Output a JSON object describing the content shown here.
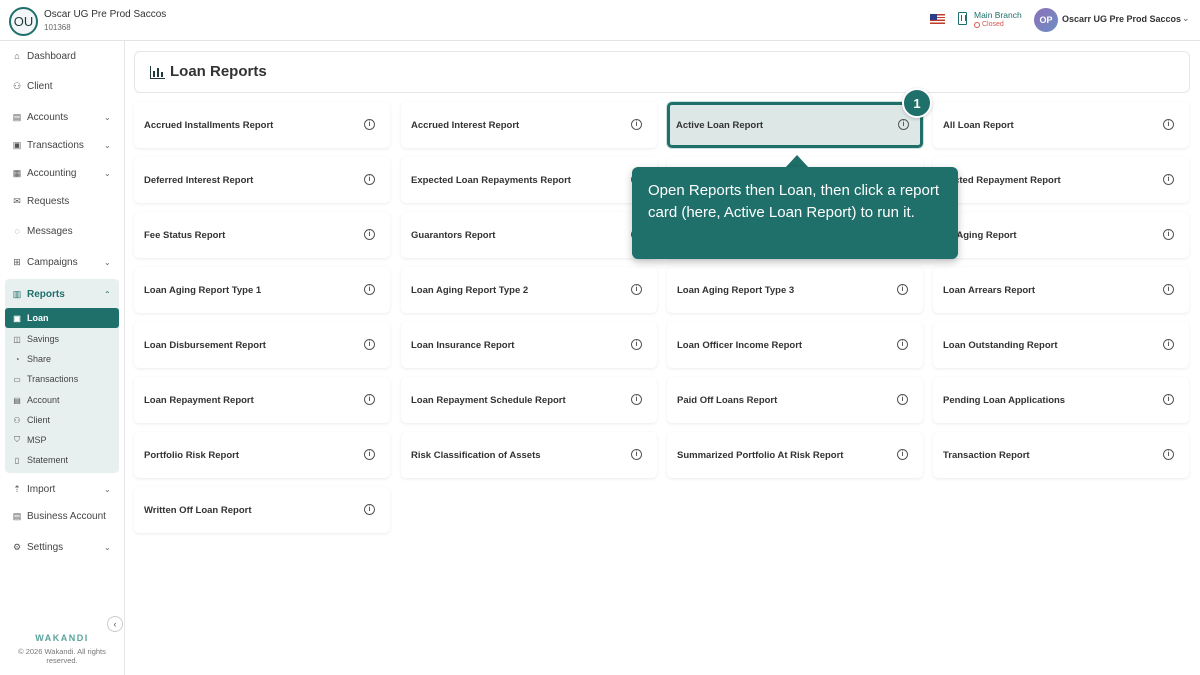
{
  "header": {
    "org_initials": "OU",
    "org_name": "Oscar UG Pre Prod Saccos",
    "org_id": "101368",
    "branch_name": "Main Branch",
    "branch_status": "Closed",
    "user_initials": "OP",
    "user_name": "Oscarr UG Pre Prod Saccos"
  },
  "sidebar": {
    "items": [
      {
        "label": "Dashboard",
        "icon": "home-icon"
      },
      {
        "label": "Client",
        "icon": "users-icon"
      },
      {
        "label": "Accounts",
        "icon": "wallet-icon"
      },
      {
        "label": "Transactions",
        "icon": "money-icon"
      },
      {
        "label": "Accounting",
        "icon": "ledger-icon"
      },
      {
        "label": "Requests",
        "icon": "mail-icon"
      },
      {
        "label": "Messages",
        "icon": "chat-icon"
      },
      {
        "label": "Campaigns",
        "icon": "grid-icon"
      },
      {
        "label": "Reports",
        "icon": "chart-icon"
      },
      {
        "label": "Import",
        "icon": "upload-icon"
      },
      {
        "label": "Business Account",
        "icon": "briefcase-icon"
      },
      {
        "label": "Settings",
        "icon": "gear-icon"
      }
    ],
    "report_subitems": [
      {
        "label": "Loan",
        "icon": "cash-icon"
      },
      {
        "label": "Savings",
        "icon": "piggy-icon"
      },
      {
        "label": "Share",
        "icon": "share-icon"
      },
      {
        "label": "Transactions",
        "icon": "card-icon"
      },
      {
        "label": "Account",
        "icon": "wallet-icon"
      },
      {
        "label": "Client",
        "icon": "users-icon"
      },
      {
        "label": "MSP",
        "icon": "shield-icon"
      },
      {
        "label": "Statement",
        "icon": "file-icon"
      }
    ],
    "brand": "WAKANDI",
    "copyright": "© 2026 Wakandi. All rights reserved."
  },
  "main": {
    "title": "Loan Reports",
    "reports": [
      "Accrued Installments Report",
      "Accrued Interest Report",
      "Active Loan Report",
      "All Loan Report",
      "Deferred Interest Report",
      "Expected Loan Repayments Report",
      "",
      "pected Repayment Report",
      "Fee Status Report",
      "Guarantors Report",
      "",
      "an Aging Report",
      "Loan Aging Report Type 1",
      "Loan Aging Report Type 2",
      "Loan Aging Report Type 3",
      "Loan Arrears Report",
      "Loan Disbursement Report",
      "Loan Insurance Report",
      "Loan Officer Income Report",
      "Loan Outstanding Report",
      "Loan Repayment Report",
      "Loan Repayment Schedule Report",
      "Paid Off Loans Report",
      "Pending Loan Applications",
      "Portfolio Risk Report",
      "Risk Classification of Assets",
      "Summarized Portfolio At Risk Report",
      "Transaction Report",
      "Written Off Loan Report"
    ]
  },
  "tooltip": {
    "step": "1",
    "text": "Open Reports then Loan, then click a report card (here, Active Loan Report) to run it."
  },
  "colors": {
    "accent": "#1f6f6a",
    "closed": "#d9534f"
  }
}
